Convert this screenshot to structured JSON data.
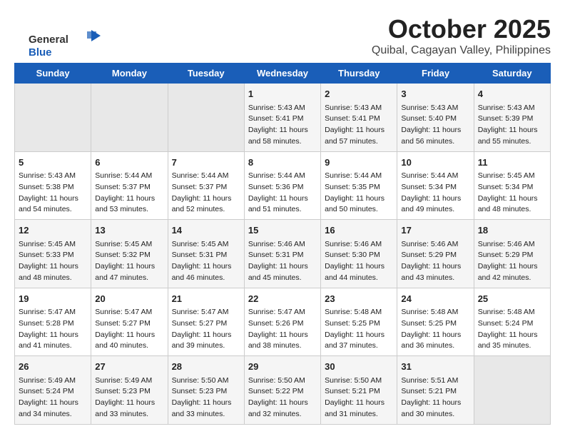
{
  "logo": {
    "general": "General",
    "blue": "Blue"
  },
  "header": {
    "month": "October 2025",
    "location": "Quibal, Cagayan Valley, Philippines"
  },
  "weekdays": [
    "Sunday",
    "Monday",
    "Tuesday",
    "Wednesday",
    "Thursday",
    "Friday",
    "Saturday"
  ],
  "weeks": [
    [
      {
        "day": "",
        "empty": true
      },
      {
        "day": "",
        "empty": true
      },
      {
        "day": "",
        "empty": true
      },
      {
        "day": "1",
        "sunrise": "5:43 AM",
        "sunset": "5:41 PM",
        "daylight": "11 hours and 58 minutes."
      },
      {
        "day": "2",
        "sunrise": "5:43 AM",
        "sunset": "5:41 PM",
        "daylight": "11 hours and 57 minutes."
      },
      {
        "day": "3",
        "sunrise": "5:43 AM",
        "sunset": "5:40 PM",
        "daylight": "11 hours and 56 minutes."
      },
      {
        "day": "4",
        "sunrise": "5:43 AM",
        "sunset": "5:39 PM",
        "daylight": "11 hours and 55 minutes."
      }
    ],
    [
      {
        "day": "5",
        "sunrise": "5:43 AM",
        "sunset": "5:38 PM",
        "daylight": "11 hours and 54 minutes."
      },
      {
        "day": "6",
        "sunrise": "5:44 AM",
        "sunset": "5:37 PM",
        "daylight": "11 hours and 53 minutes."
      },
      {
        "day": "7",
        "sunrise": "5:44 AM",
        "sunset": "5:37 PM",
        "daylight": "11 hours and 52 minutes."
      },
      {
        "day": "8",
        "sunrise": "5:44 AM",
        "sunset": "5:36 PM",
        "daylight": "11 hours and 51 minutes."
      },
      {
        "day": "9",
        "sunrise": "5:44 AM",
        "sunset": "5:35 PM",
        "daylight": "11 hours and 50 minutes."
      },
      {
        "day": "10",
        "sunrise": "5:44 AM",
        "sunset": "5:34 PM",
        "daylight": "11 hours and 49 minutes."
      },
      {
        "day": "11",
        "sunrise": "5:45 AM",
        "sunset": "5:34 PM",
        "daylight": "11 hours and 48 minutes."
      }
    ],
    [
      {
        "day": "12",
        "sunrise": "5:45 AM",
        "sunset": "5:33 PM",
        "daylight": "11 hours and 48 minutes."
      },
      {
        "day": "13",
        "sunrise": "5:45 AM",
        "sunset": "5:32 PM",
        "daylight": "11 hours and 47 minutes."
      },
      {
        "day": "14",
        "sunrise": "5:45 AM",
        "sunset": "5:31 PM",
        "daylight": "11 hours and 46 minutes."
      },
      {
        "day": "15",
        "sunrise": "5:46 AM",
        "sunset": "5:31 PM",
        "daylight": "11 hours and 45 minutes."
      },
      {
        "day": "16",
        "sunrise": "5:46 AM",
        "sunset": "5:30 PM",
        "daylight": "11 hours and 44 minutes."
      },
      {
        "day": "17",
        "sunrise": "5:46 AM",
        "sunset": "5:29 PM",
        "daylight": "11 hours and 43 minutes."
      },
      {
        "day": "18",
        "sunrise": "5:46 AM",
        "sunset": "5:29 PM",
        "daylight": "11 hours and 42 minutes."
      }
    ],
    [
      {
        "day": "19",
        "sunrise": "5:47 AM",
        "sunset": "5:28 PM",
        "daylight": "11 hours and 41 minutes."
      },
      {
        "day": "20",
        "sunrise": "5:47 AM",
        "sunset": "5:27 PM",
        "daylight": "11 hours and 40 minutes."
      },
      {
        "day": "21",
        "sunrise": "5:47 AM",
        "sunset": "5:27 PM",
        "daylight": "11 hours and 39 minutes."
      },
      {
        "day": "22",
        "sunrise": "5:47 AM",
        "sunset": "5:26 PM",
        "daylight": "11 hours and 38 minutes."
      },
      {
        "day": "23",
        "sunrise": "5:48 AM",
        "sunset": "5:25 PM",
        "daylight": "11 hours and 37 minutes."
      },
      {
        "day": "24",
        "sunrise": "5:48 AM",
        "sunset": "5:25 PM",
        "daylight": "11 hours and 36 minutes."
      },
      {
        "day": "25",
        "sunrise": "5:48 AM",
        "sunset": "5:24 PM",
        "daylight": "11 hours and 35 minutes."
      }
    ],
    [
      {
        "day": "26",
        "sunrise": "5:49 AM",
        "sunset": "5:24 PM",
        "daylight": "11 hours and 34 minutes."
      },
      {
        "day": "27",
        "sunrise": "5:49 AM",
        "sunset": "5:23 PM",
        "daylight": "11 hours and 33 minutes."
      },
      {
        "day": "28",
        "sunrise": "5:50 AM",
        "sunset": "5:23 PM",
        "daylight": "11 hours and 33 minutes."
      },
      {
        "day": "29",
        "sunrise": "5:50 AM",
        "sunset": "5:22 PM",
        "daylight": "11 hours and 32 minutes."
      },
      {
        "day": "30",
        "sunrise": "5:50 AM",
        "sunset": "5:21 PM",
        "daylight": "11 hours and 31 minutes."
      },
      {
        "day": "31",
        "sunrise": "5:51 AM",
        "sunset": "5:21 PM",
        "daylight": "11 hours and 30 minutes."
      },
      {
        "day": "",
        "empty": true
      }
    ]
  ],
  "labels": {
    "sunrise": "Sunrise:",
    "sunset": "Sunset:",
    "daylight": "Daylight:"
  }
}
